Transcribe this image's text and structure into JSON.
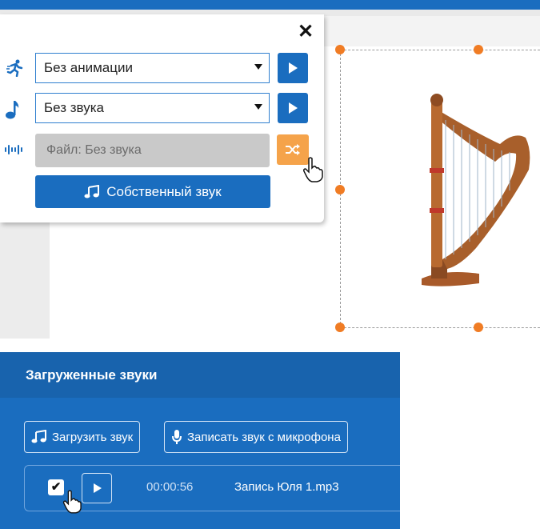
{
  "popup": {
    "close_label": "✕",
    "animation_select": {
      "value": "Без анимации"
    },
    "sound_select": {
      "value": "Без звука"
    },
    "file_field": {
      "value": "Файл: Без звука"
    },
    "own_sound_button": {
      "label": "Собственный звук",
      "icon": "music-note-icon"
    },
    "row_icons": [
      "running-figure-icon",
      "music-note-icon",
      "sound-wave-icon"
    ],
    "shuffle_icon": "shuffle-icon"
  },
  "canvas": {
    "image": "harp-image"
  },
  "uploaded_sounds": {
    "title": "Загруженные звуки",
    "upload_button": {
      "label": "Загрузить звук",
      "icon": "music-note-icon"
    },
    "record_button": {
      "label": "Записать звук с микрофона",
      "icon": "microphone-icon"
    },
    "items": [
      {
        "checked": true,
        "duration": "00:00:56",
        "name": "Запись Юля 1.mp3"
      }
    ]
  },
  "colors": {
    "primary_blue": "#1a6dbf",
    "header_blue": "#1863ad",
    "accent_orange": "#f5a34a",
    "handle_orange": "#f07c24",
    "disabled_gray": "#c9c9c9"
  }
}
